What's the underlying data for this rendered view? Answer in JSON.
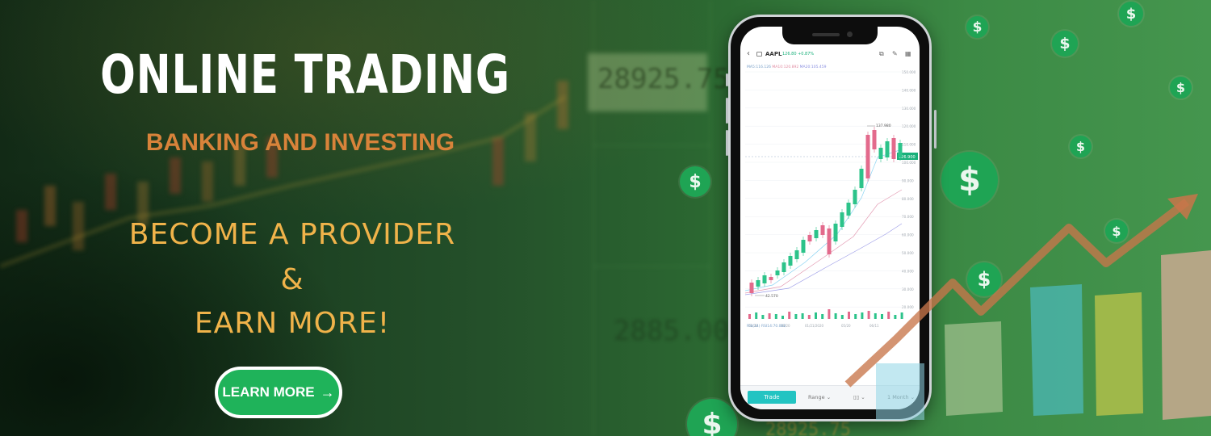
{
  "banner": {
    "title": "ONLINE TRADING",
    "subtitle": "BANKING AND INVESTING",
    "cta_lines": [
      "BECOME A PROVIDER",
      "&",
      "EARN MORE!"
    ],
    "learn_more": {
      "label": "LEARN MORE",
      "arrow": "→"
    },
    "coin_symbol": "$",
    "background_ticker_values": [
      "28925.75",
      "2885.00",
      "28925.75"
    ],
    "colors": {
      "title": "#ffffff",
      "subtitle": "#d8833a",
      "cta": "#f0b34a",
      "button": "#1fb35a",
      "coin": "#1fa454",
      "candle_up": "#2cc38a",
      "candle_down": "#e36a8c"
    }
  },
  "phone_app": {
    "ticker": "AAPL",
    "quote": "126.80 +0.87%",
    "ma_legend": [
      "MA5:116.126",
      "MA10:120.892",
      "MA20:105.459"
    ],
    "high_label": "137.980",
    "low_label": "42.570",
    "current_price_label": "126.900",
    "price_axis": [
      "150.000",
      "140.000",
      "130.000",
      "120.000",
      "110.000",
      "100.000",
      "90.000",
      "80.000",
      "70.000",
      "60.000",
      "50.000",
      "40.000",
      "30.000",
      "20.000"
    ],
    "date_axis": [
      "01/20",
      "08/20",
      "01/21/2020",
      "05/20",
      "06/11"
    ],
    "rsi_label": "RSI(14) RSI14:70.002",
    "tabbar": {
      "trade": "Trade",
      "range": "Range",
      "range_icon": "chevron-down",
      "interval": "1 Month"
    }
  }
}
